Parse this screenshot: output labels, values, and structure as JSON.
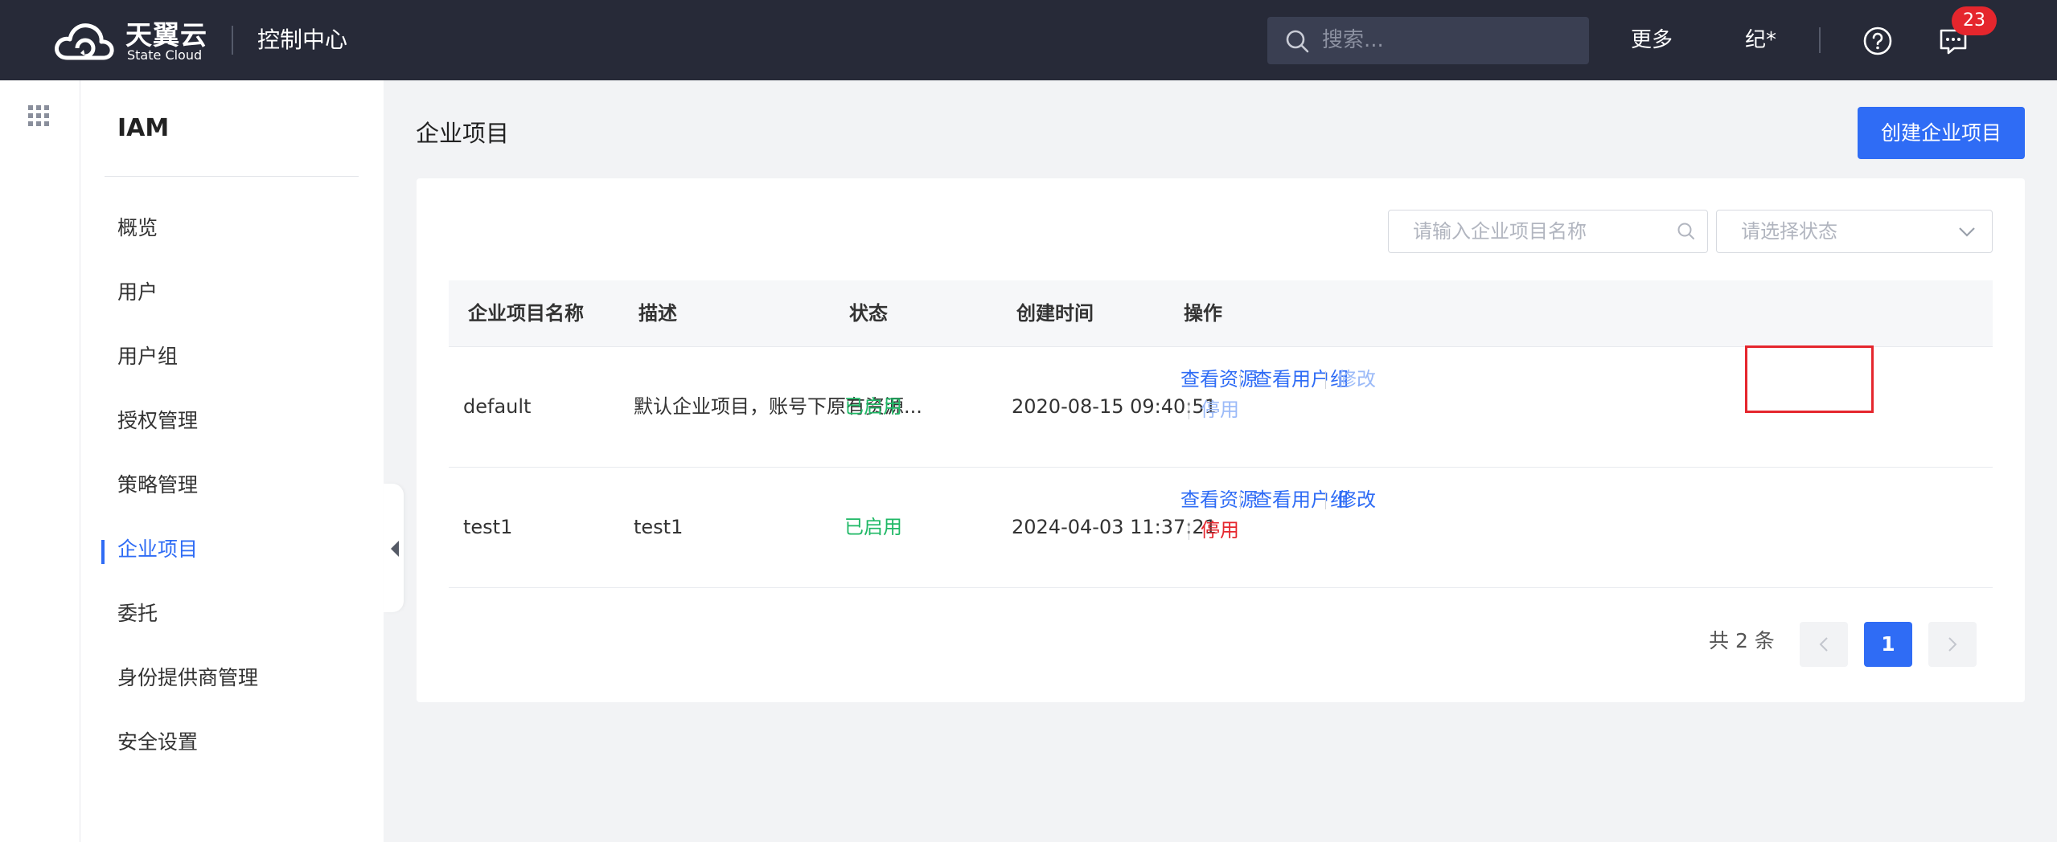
{
  "header": {
    "brand_cn": "天翼云",
    "brand_en": "State Cloud",
    "console_title": "控制中心",
    "search_placeholder": "搜索...",
    "more_label": "更多",
    "user_label": "纪*",
    "message_count": "23"
  },
  "sidebar": {
    "title": "IAM",
    "items": [
      {
        "label": "概览"
      },
      {
        "label": "用户"
      },
      {
        "label": "用户组"
      },
      {
        "label": "授权管理"
      },
      {
        "label": "策略管理"
      },
      {
        "label": "企业项目",
        "active": true
      },
      {
        "label": "委托"
      },
      {
        "label": "身份提供商管理"
      },
      {
        "label": "安全设置"
      }
    ]
  },
  "main": {
    "page_title": "企业项目",
    "create_button": "创建企业项目",
    "filters": {
      "name_placeholder": "请输入企业项目名称",
      "status_placeholder": "请选择状态"
    },
    "table": {
      "columns": [
        "企业项目名称",
        "描述",
        "状态",
        "创建时间",
        "操作"
      ],
      "rows": [
        {
          "name": "default",
          "description": "默认企业项目，账号下原有资源...",
          "status": "已启用",
          "created": "2020-08-15 09:40:51",
          "actions": {
            "view_resources": "查看资源",
            "view_groups": "查看用户组",
            "edit": "修改",
            "disable": "停用"
          }
        },
        {
          "name": "test1",
          "description": "test1",
          "status": "已启用",
          "created": "2024-04-03 11:37:21",
          "actions": {
            "view_resources": "查看资源",
            "view_groups": "查看用户组",
            "edit": "修改",
            "disable": "停用"
          }
        }
      ]
    },
    "pagination": {
      "total_text": "共 2 条",
      "current_page": "1"
    }
  },
  "colors": {
    "topbar": "#272a38",
    "accent": "#2f6cf5",
    "status_enabled": "#1fb866",
    "danger": "#e5262d"
  },
  "icons": [
    "cloud-logo-icon",
    "search-icon",
    "help-icon",
    "message-icon",
    "apps-grid-icon",
    "collapse-left-icon",
    "chevron-down-icon",
    "chevron-left-icon",
    "chevron-right-icon"
  ]
}
